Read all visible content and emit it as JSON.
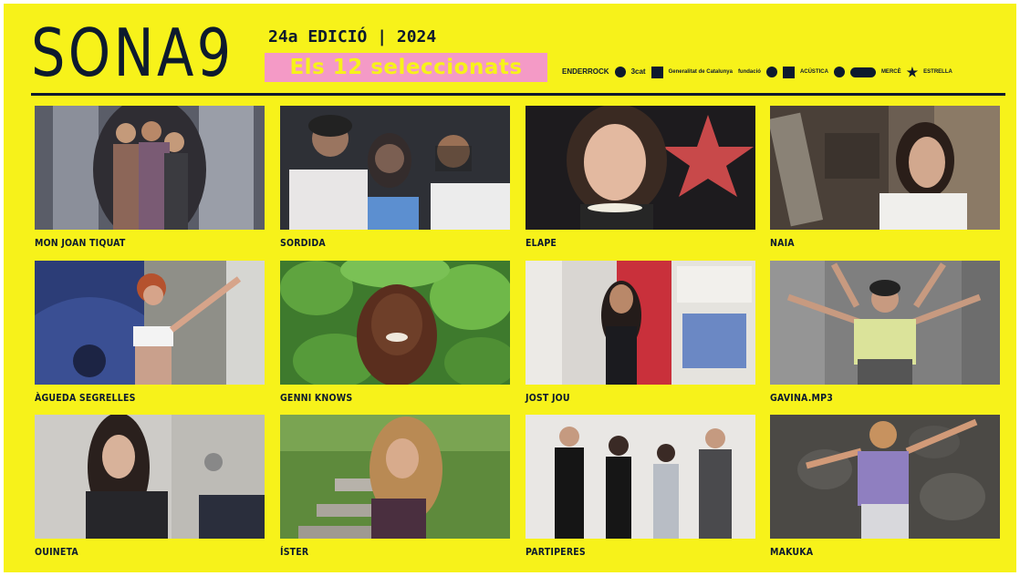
{
  "header": {
    "logo_text": "SONA9",
    "edition": "24a EDICIÓ | 2024",
    "subtitle": "Els 12 seleccionats"
  },
  "sponsors": [
    "ENDERROCK",
    "3cat",
    "Generalitat de Catalunya",
    "fundació",
    "ACÚSTICA",
    "MERCÈ",
    "ESTRELLA"
  ],
  "artists": [
    {
      "name": "MON JOAN TIQUAT"
    },
    {
      "name": "SORDIDA"
    },
    {
      "name": "ELAPE"
    },
    {
      "name": "NAIA"
    },
    {
      "name": "ÀGUEDA SEGRELLES"
    },
    {
      "name": "GENNI KNOWS"
    },
    {
      "name": "JOST JOU"
    },
    {
      "name": "GAVINA.MP3"
    },
    {
      "name": "OUINETA"
    },
    {
      "name": "ÍSTER"
    },
    {
      "name": "PARTIPERES"
    },
    {
      "name": "MAKUKA"
    }
  ],
  "colors": {
    "background": "#f7f21a",
    "ink": "#0d1a2e",
    "badge": "#f49ac6"
  }
}
